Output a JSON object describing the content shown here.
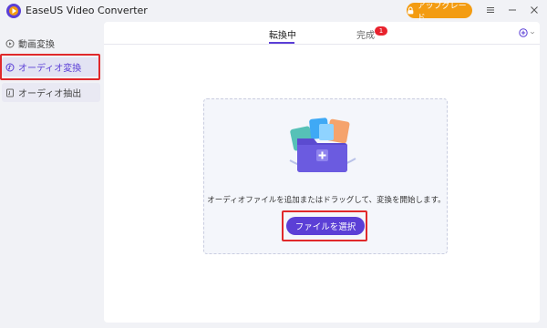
{
  "app": {
    "title": "EaseUS Video Converter",
    "upgrade_label": "アップグレード",
    "accent_color": "#5b3fd6",
    "upgrade_color": "#f39c12"
  },
  "window_controls": {
    "menu_icon": "hamburger-icon",
    "minimize_icon": "minimize-icon",
    "close_icon": "close-icon"
  },
  "sidebar": {
    "items": [
      {
        "label": "動画変換",
        "icon": "video-convert-icon"
      },
      {
        "label": "オーディオ変換",
        "icon": "audio-convert-icon",
        "active": true
      },
      {
        "label": "オーディオ抽出",
        "icon": "audio-extract-icon"
      }
    ]
  },
  "main": {
    "tabs": [
      {
        "label": "転換中",
        "active": true
      },
      {
        "label": "完成",
        "badge": "1"
      }
    ],
    "add_icon": "plus-circle-icon",
    "dropzone": {
      "hint": "オーディオファイルを追加またはドラッグして、変換を開始します。",
      "button_label": "ファイルを選択"
    }
  }
}
